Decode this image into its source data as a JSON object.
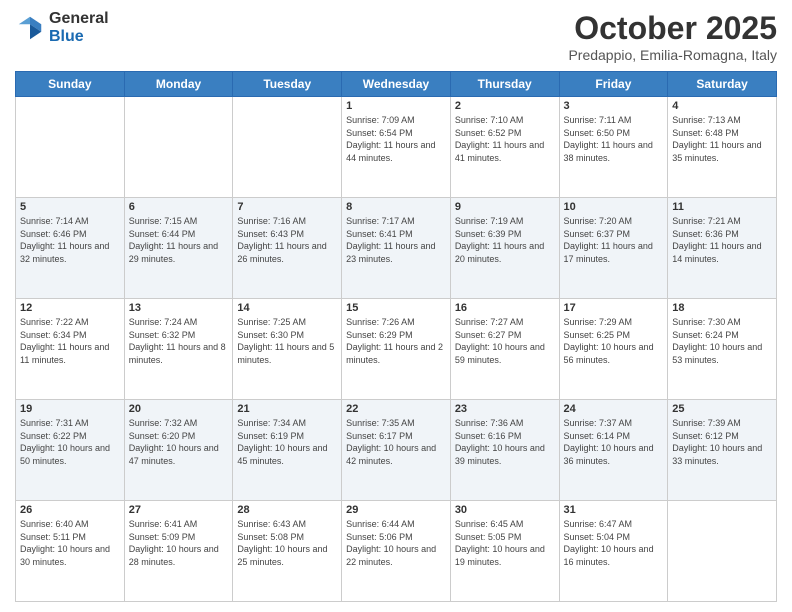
{
  "header": {
    "logo_general": "General",
    "logo_blue": "Blue",
    "month": "October 2025",
    "location": "Predappio, Emilia-Romagna, Italy"
  },
  "days_of_week": [
    "Sunday",
    "Monday",
    "Tuesday",
    "Wednesday",
    "Thursday",
    "Friday",
    "Saturday"
  ],
  "weeks": [
    [
      {
        "day": "",
        "sunrise": "",
        "sunset": "",
        "daylight": ""
      },
      {
        "day": "",
        "sunrise": "",
        "sunset": "",
        "daylight": ""
      },
      {
        "day": "",
        "sunrise": "",
        "sunset": "",
        "daylight": ""
      },
      {
        "day": "1",
        "sunrise": "Sunrise: 7:09 AM",
        "sunset": "Sunset: 6:54 PM",
        "daylight": "Daylight: 11 hours and 44 minutes."
      },
      {
        "day": "2",
        "sunrise": "Sunrise: 7:10 AM",
        "sunset": "Sunset: 6:52 PM",
        "daylight": "Daylight: 11 hours and 41 minutes."
      },
      {
        "day": "3",
        "sunrise": "Sunrise: 7:11 AM",
        "sunset": "Sunset: 6:50 PM",
        "daylight": "Daylight: 11 hours and 38 minutes."
      },
      {
        "day": "4",
        "sunrise": "Sunrise: 7:13 AM",
        "sunset": "Sunset: 6:48 PM",
        "daylight": "Daylight: 11 hours and 35 minutes."
      }
    ],
    [
      {
        "day": "5",
        "sunrise": "Sunrise: 7:14 AM",
        "sunset": "Sunset: 6:46 PM",
        "daylight": "Daylight: 11 hours and 32 minutes."
      },
      {
        "day": "6",
        "sunrise": "Sunrise: 7:15 AM",
        "sunset": "Sunset: 6:44 PM",
        "daylight": "Daylight: 11 hours and 29 minutes."
      },
      {
        "day": "7",
        "sunrise": "Sunrise: 7:16 AM",
        "sunset": "Sunset: 6:43 PM",
        "daylight": "Daylight: 11 hours and 26 minutes."
      },
      {
        "day": "8",
        "sunrise": "Sunrise: 7:17 AM",
        "sunset": "Sunset: 6:41 PM",
        "daylight": "Daylight: 11 hours and 23 minutes."
      },
      {
        "day": "9",
        "sunrise": "Sunrise: 7:19 AM",
        "sunset": "Sunset: 6:39 PM",
        "daylight": "Daylight: 11 hours and 20 minutes."
      },
      {
        "day": "10",
        "sunrise": "Sunrise: 7:20 AM",
        "sunset": "Sunset: 6:37 PM",
        "daylight": "Daylight: 11 hours and 17 minutes."
      },
      {
        "day": "11",
        "sunrise": "Sunrise: 7:21 AM",
        "sunset": "Sunset: 6:36 PM",
        "daylight": "Daylight: 11 hours and 14 minutes."
      }
    ],
    [
      {
        "day": "12",
        "sunrise": "Sunrise: 7:22 AM",
        "sunset": "Sunset: 6:34 PM",
        "daylight": "Daylight: 11 hours and 11 minutes."
      },
      {
        "day": "13",
        "sunrise": "Sunrise: 7:24 AM",
        "sunset": "Sunset: 6:32 PM",
        "daylight": "Daylight: 11 hours and 8 minutes."
      },
      {
        "day": "14",
        "sunrise": "Sunrise: 7:25 AM",
        "sunset": "Sunset: 6:30 PM",
        "daylight": "Daylight: 11 hours and 5 minutes."
      },
      {
        "day": "15",
        "sunrise": "Sunrise: 7:26 AM",
        "sunset": "Sunset: 6:29 PM",
        "daylight": "Daylight: 11 hours and 2 minutes."
      },
      {
        "day": "16",
        "sunrise": "Sunrise: 7:27 AM",
        "sunset": "Sunset: 6:27 PM",
        "daylight": "Daylight: 10 hours and 59 minutes."
      },
      {
        "day": "17",
        "sunrise": "Sunrise: 7:29 AM",
        "sunset": "Sunset: 6:25 PM",
        "daylight": "Daylight: 10 hours and 56 minutes."
      },
      {
        "day": "18",
        "sunrise": "Sunrise: 7:30 AM",
        "sunset": "Sunset: 6:24 PM",
        "daylight": "Daylight: 10 hours and 53 minutes."
      }
    ],
    [
      {
        "day": "19",
        "sunrise": "Sunrise: 7:31 AM",
        "sunset": "Sunset: 6:22 PM",
        "daylight": "Daylight: 10 hours and 50 minutes."
      },
      {
        "day": "20",
        "sunrise": "Sunrise: 7:32 AM",
        "sunset": "Sunset: 6:20 PM",
        "daylight": "Daylight: 10 hours and 47 minutes."
      },
      {
        "day": "21",
        "sunrise": "Sunrise: 7:34 AM",
        "sunset": "Sunset: 6:19 PM",
        "daylight": "Daylight: 10 hours and 45 minutes."
      },
      {
        "day": "22",
        "sunrise": "Sunrise: 7:35 AM",
        "sunset": "Sunset: 6:17 PM",
        "daylight": "Daylight: 10 hours and 42 minutes."
      },
      {
        "day": "23",
        "sunrise": "Sunrise: 7:36 AM",
        "sunset": "Sunset: 6:16 PM",
        "daylight": "Daylight: 10 hours and 39 minutes."
      },
      {
        "day": "24",
        "sunrise": "Sunrise: 7:37 AM",
        "sunset": "Sunset: 6:14 PM",
        "daylight": "Daylight: 10 hours and 36 minutes."
      },
      {
        "day": "25",
        "sunrise": "Sunrise: 7:39 AM",
        "sunset": "Sunset: 6:12 PM",
        "daylight": "Daylight: 10 hours and 33 minutes."
      }
    ],
    [
      {
        "day": "26",
        "sunrise": "Sunrise: 6:40 AM",
        "sunset": "Sunset: 5:11 PM",
        "daylight": "Daylight: 10 hours and 30 minutes."
      },
      {
        "day": "27",
        "sunrise": "Sunrise: 6:41 AM",
        "sunset": "Sunset: 5:09 PM",
        "daylight": "Daylight: 10 hours and 28 minutes."
      },
      {
        "day": "28",
        "sunrise": "Sunrise: 6:43 AM",
        "sunset": "Sunset: 5:08 PM",
        "daylight": "Daylight: 10 hours and 25 minutes."
      },
      {
        "day": "29",
        "sunrise": "Sunrise: 6:44 AM",
        "sunset": "Sunset: 5:06 PM",
        "daylight": "Daylight: 10 hours and 22 minutes."
      },
      {
        "day": "30",
        "sunrise": "Sunrise: 6:45 AM",
        "sunset": "Sunset: 5:05 PM",
        "daylight": "Daylight: 10 hours and 19 minutes."
      },
      {
        "day": "31",
        "sunrise": "Sunrise: 6:47 AM",
        "sunset": "Sunset: 5:04 PM",
        "daylight": "Daylight: 10 hours and 16 minutes."
      },
      {
        "day": "",
        "sunrise": "",
        "sunset": "",
        "daylight": ""
      }
    ]
  ]
}
